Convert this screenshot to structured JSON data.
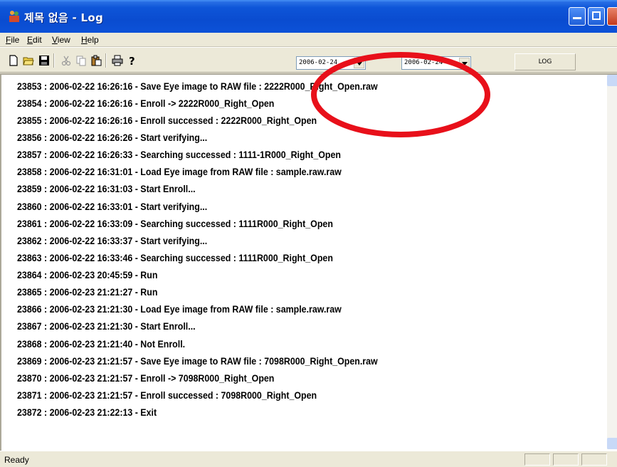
{
  "window": {
    "title": "제목 없음 - Log"
  },
  "menu": [
    {
      "label": "File"
    },
    {
      "label": "Edit"
    },
    {
      "label": "View"
    },
    {
      "label": "Help"
    }
  ],
  "toolbar": {
    "icons": [
      "new-icon",
      "open-icon",
      "save-icon",
      "cut-icon",
      "copy-icon",
      "paste-icon",
      "print-icon",
      "about-icon"
    ],
    "date_from": "2006-02-24",
    "date_to": "2006-02-24",
    "log_label": "LOG"
  },
  "log_lines": [
    "23853 : 2006-02-22 16:26:16 - Save Eye image to RAW file : 2222R000_Right_Open.raw",
    "23854 : 2006-02-22 16:26:16 - Enroll -> 2222R000_Right_Open",
    "23855 : 2006-02-22 16:26:16 - Enroll successed : 2222R000_Right_Open",
    "23856 : 2006-02-22 16:26:26 - Start verifying...",
    "23857 : 2006-02-22 16:26:33 - Searching successed : 1111-1R000_Right_Open",
    "23858 : 2006-02-22 16:31:01 - Load Eye image from RAW file : sample.raw.raw",
    "23859 : 2006-02-22 16:31:03 - Start Enroll...",
    "23860 : 2006-02-22 16:33:01 - Start verifying...",
    "23861 : 2006-02-22 16:33:09 - Searching successed : 1111R000_Right_Open",
    "23862 : 2006-02-22 16:33:37 - Start verifying...",
    "23863 : 2006-02-22 16:33:46 - Searching successed : 1111R000_Right_Open",
    "23864 : 2006-02-23 20:45:59 - Run",
    "23865 : 2006-02-23 21:21:27 - Run",
    "23866 : 2006-02-23 21:21:30 - Load Eye image from RAW file : sample.raw.raw",
    "23867 : 2006-02-23 21:21:30 - Start Enroll...",
    "23868 : 2006-02-23 21:21:40 - Not Enroll.",
    "23869 : 2006-02-23 21:21:57 - Save Eye image to RAW file : 7098R000_Right_Open.raw",
    "23870 : 2006-02-23 21:21:57 - Enroll -> 7098R000_Right_Open",
    "23871 : 2006-02-23 21:21:57 - Enroll successed : 7098R000_Right_Open",
    "23872 : 2006-02-23 21:22:13 - Exit"
  ],
  "status": {
    "text": "Ready"
  },
  "colors": {
    "titlebar": "#0a4cd0",
    "highlight": "#e8101a"
  }
}
